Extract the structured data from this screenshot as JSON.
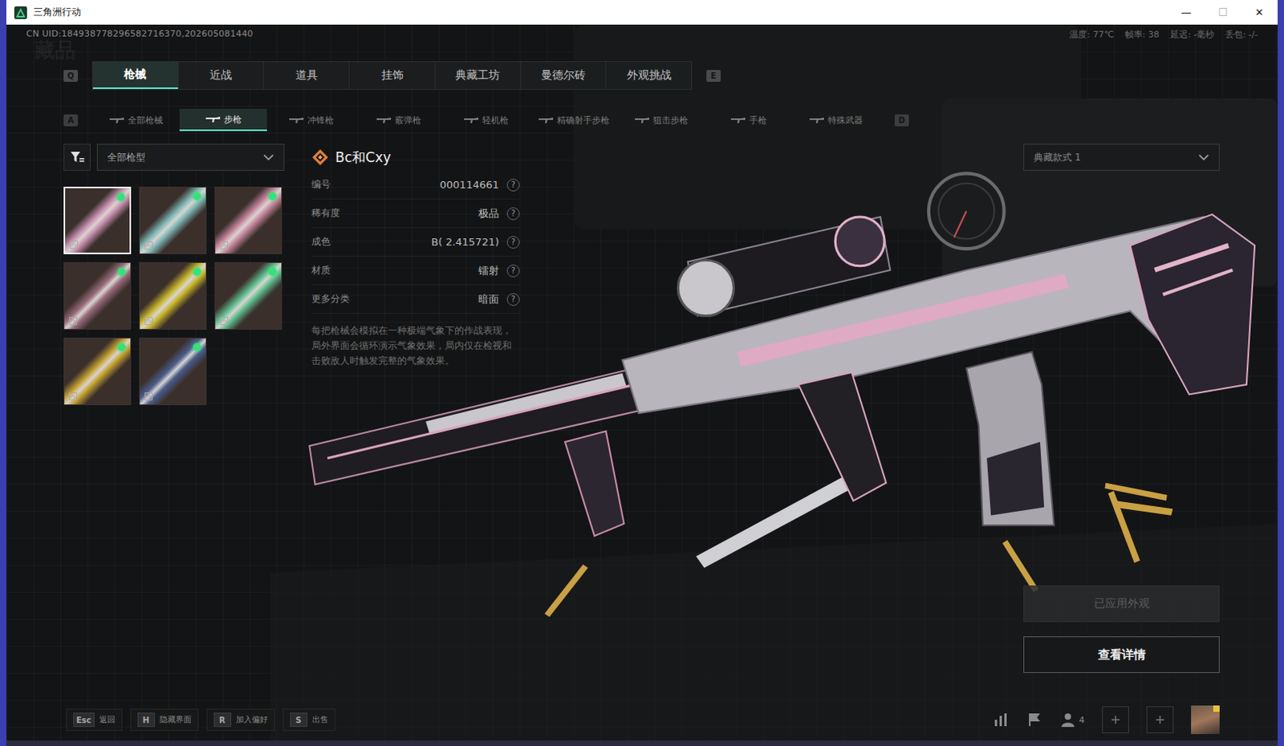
{
  "window": {
    "title": "三角洲行动",
    "controls": [
      "—",
      "☐",
      "✕"
    ]
  },
  "header": {
    "uid": "CN UID:184938778296582716370,202605081440",
    "watermark": "藏品",
    "stats": [
      "温度: 77℃",
      "帧率: 38",
      "延迟: -毫秒",
      "丢包: -/-"
    ]
  },
  "main_tabs": {
    "prev_key": "Q",
    "next_key": "E",
    "items": [
      {
        "label": "枪械",
        "selected": true
      },
      {
        "label": "近战",
        "selected": false
      },
      {
        "label": "道具",
        "selected": false
      },
      {
        "label": "挂饰",
        "selected": false
      },
      {
        "label": "典藏工坊",
        "selected": false
      },
      {
        "label": "曼德尔砖",
        "selected": false
      },
      {
        "label": "外观挑战",
        "selected": false
      }
    ]
  },
  "sub_tabs": {
    "prev_key": "A",
    "next_key": "D",
    "items": [
      {
        "label": "全部枪械",
        "selected": false
      },
      {
        "label": "步枪",
        "selected": true
      },
      {
        "label": "冲锋枪",
        "selected": false
      },
      {
        "label": "霰弹枪",
        "selected": false
      },
      {
        "label": "轻机枪",
        "selected": false
      },
      {
        "label": "精确射手步枪",
        "selected": false
      },
      {
        "label": "狙击步枪",
        "selected": false
      },
      {
        "label": "手枪",
        "selected": false
      },
      {
        "label": "特殊武器",
        "selected": false
      }
    ]
  },
  "filter": {
    "value": "全部枪型"
  },
  "skins": [
    {
      "selected": true,
      "equipped": true,
      "color": "#c98fb0"
    },
    {
      "selected": false,
      "equipped": true,
      "color": "#7fb8b5"
    },
    {
      "selected": false,
      "equipped": true,
      "color": "#c9879f"
    },
    {
      "selected": false,
      "equipped": true,
      "color": "#9a6a7c"
    },
    {
      "selected": false,
      "equipped": true,
      "color": "#c9b52a"
    },
    {
      "selected": false,
      "equipped": true,
      "color": "#5fbf8f"
    },
    {
      "selected": false,
      "equipped": true,
      "color": "#c7a332"
    },
    {
      "selected": false,
      "equipped": true,
      "color": "#4a5c8c"
    }
  ],
  "detail": {
    "name": "Bc和Cxy",
    "rows": [
      {
        "label": "编号",
        "value": "000114661",
        "help": "?"
      },
      {
        "label": "稀有度",
        "value": "极品",
        "help": "?"
      },
      {
        "label": "成色",
        "value": "B( 2.415721)",
        "help": "?"
      },
      {
        "label": "材质",
        "value": "镭射",
        "help": "?"
      },
      {
        "label": "更多分类",
        "value": "暗面",
        "help": "?"
      }
    ],
    "description": "每把枪械会模拟在一种极端气象下的作战表现，局外界面会循环演示气象效果，局内仅在检视和击败敌人时触发完整的气象效果。"
  },
  "style_select": {
    "value": "典藏款式 1"
  },
  "buttons": [
    {
      "label": "已应用外观",
      "disabled": true
    },
    {
      "label": "查看详情",
      "disabled": false
    }
  ],
  "hints": [
    {
      "key": "Esc",
      "label": "返回"
    },
    {
      "key": "H",
      "label": "隐藏界面"
    },
    {
      "key": "R",
      "label": "加入偏好"
    },
    {
      "key": "S",
      "label": "出售"
    }
  ],
  "footer": {
    "friends": "4"
  }
}
